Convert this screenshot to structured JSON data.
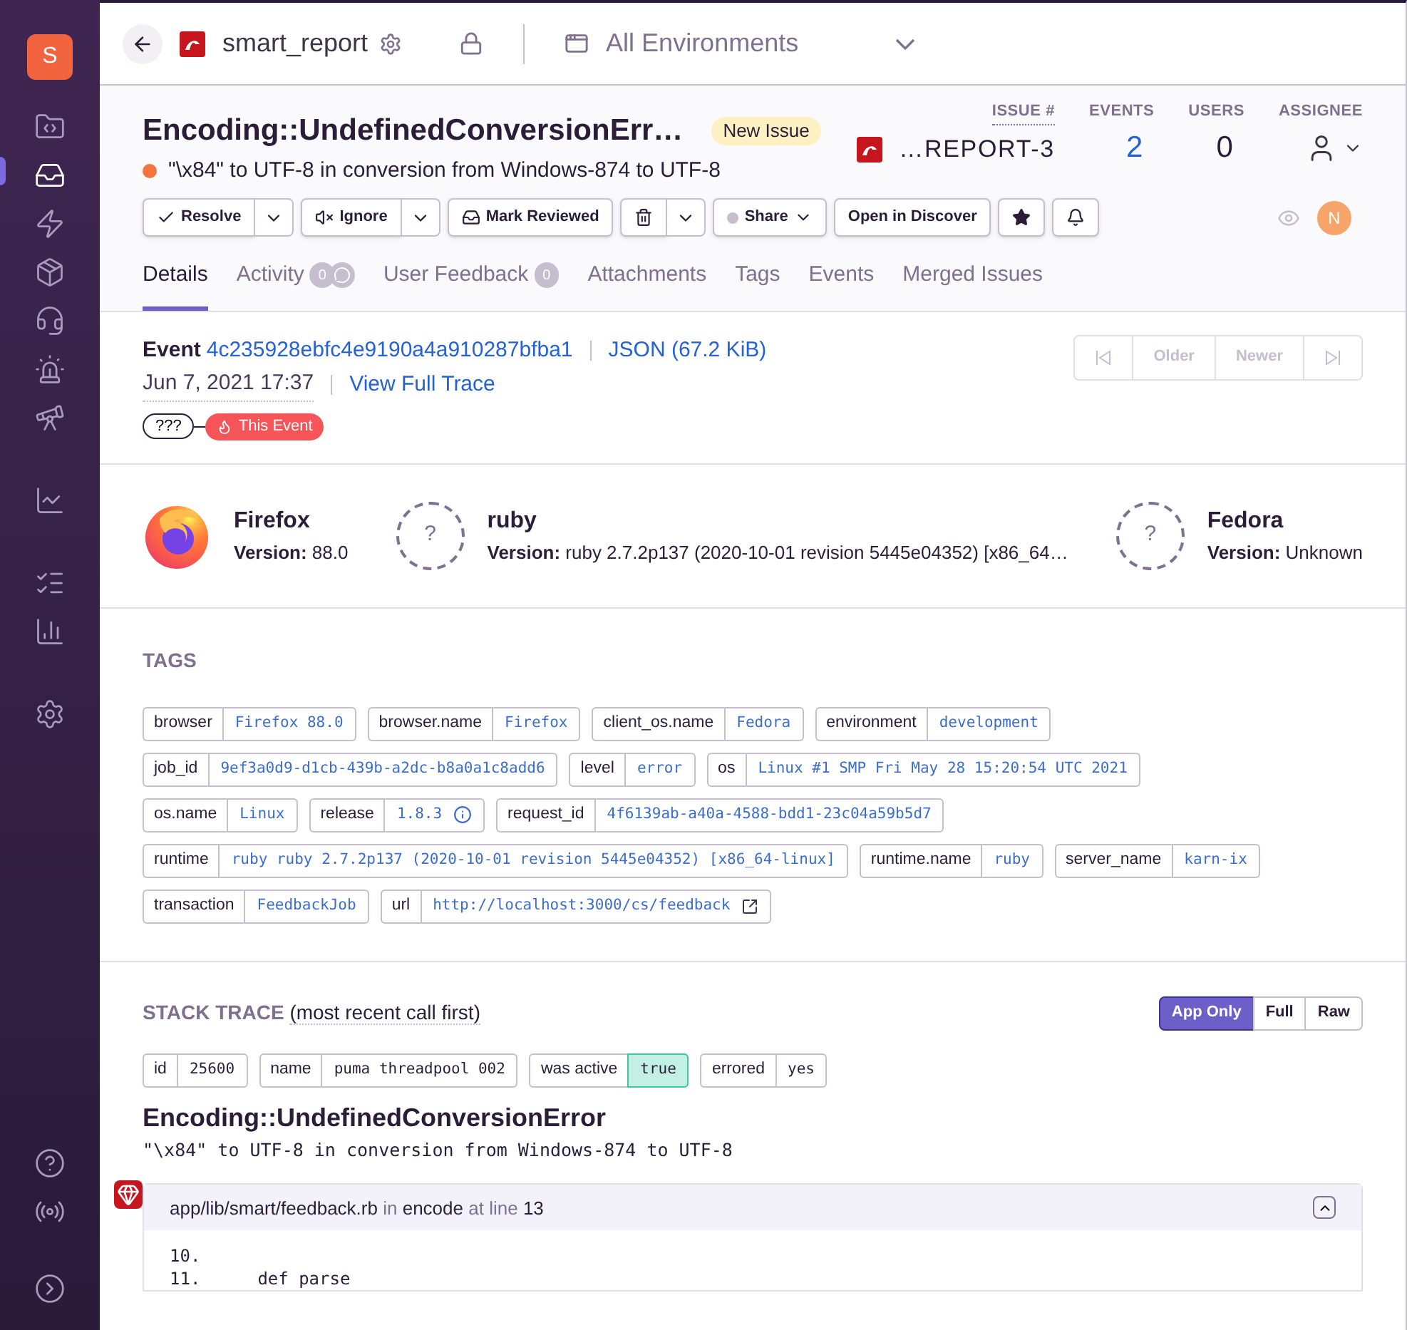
{
  "sidebar": {
    "org_initial": "S",
    "items": [
      {
        "selected": false
      },
      {
        "selected": true
      },
      {
        "selected": false
      },
      {
        "selected": false
      },
      {
        "selected": false
      },
      {
        "selected": false
      },
      {
        "selected": false
      },
      {
        "selected": false
      },
      {
        "selected": false
      },
      {
        "selected": false
      },
      {
        "selected": false
      }
    ]
  },
  "top_bar": {
    "project": "smart_report",
    "environment": "All Environments"
  },
  "issue": {
    "title": "Encoding::UndefinedConversionErr…",
    "badge": "New Issue",
    "message": "\"\\x84\" to UTF-8 in conversion from Windows-874 to UTF-8",
    "stats": [
      {
        "label": "ISSUE #",
        "value": "…REPORT-3",
        "kind": "id"
      },
      {
        "label": "EVENTS",
        "value": "2",
        "kind": "link"
      },
      {
        "label": "USERS",
        "value": "0",
        "kind": "plain"
      },
      {
        "label": "ASSIGNEE",
        "kind": "assignee"
      }
    ],
    "actions": [
      {
        "label": "Resolve",
        "kind": "split"
      },
      {
        "label": "Ignore",
        "kind": "split"
      },
      {
        "label": "Mark Reviewed",
        "kind": "plain"
      },
      {
        "kind": "split"
      },
      {
        "label": "Share",
        "kind": "menu"
      },
      {
        "label": "Open in Discover",
        "kind": "plain"
      },
      {
        "kind": "plain"
      },
      {
        "kind": "plain"
      }
    ],
    "viewer_initial": "N",
    "tabs": [
      {
        "label": "Details",
        "selected": true
      },
      {
        "label": "Activity",
        "count": "0",
        "selected": false
      },
      {
        "label": "User Feedback",
        "count": "0",
        "selected": false
      },
      {
        "label": "Attachments",
        "selected": false
      },
      {
        "label": "Tags",
        "selected": false
      },
      {
        "label": "Events",
        "selected": false
      },
      {
        "label": "Merged Issues",
        "selected": false
      }
    ]
  },
  "event": {
    "label": "Event",
    "id": "4c235928ebfc4e9190a4a910287bfba1",
    "json": "JSON (67.2 KiB)",
    "date": "Jun 7, 2021 17:37",
    "trace": "View Full Trace",
    "nav": [
      {
        "disabled": true
      },
      {
        "label": "Older",
        "disabled": true
      },
      {
        "label": "Newer",
        "disabled": true
      },
      {
        "disabled": true
      }
    ],
    "trace_node": "???",
    "this_event": "This Event"
  },
  "contexts": [
    {
      "name": "Firefox",
      "version_label": "Version:",
      "version": "88.0",
      "kind": "firefox"
    },
    {
      "name": "ruby",
      "version_label": "Version:",
      "version": "ruby 2.7.2p137 (2020-10-01 revision 5445e04352) [x86_64…",
      "kind": "unknown",
      "glyph": "?"
    },
    {
      "name": "Fedora",
      "version_label": "Version:",
      "version": "Unknown",
      "kind": "unknown",
      "glyph": "?"
    }
  ],
  "tags": {
    "title": "TAGS",
    "items": [
      {
        "key": "browser",
        "value": "Firefox 88.0",
        "kind": "plain"
      },
      {
        "key": "browser.name",
        "value": "Firefox",
        "kind": "plain"
      },
      {
        "key": "client_os.name",
        "value": "Fedora",
        "kind": "plain"
      },
      {
        "key": "environment",
        "value": "development",
        "kind": "plain"
      },
      {
        "key": "job_id",
        "value": "9ef3a0d9-d1cb-439b-a2dc-b8a0a1c8add6",
        "kind": "plain"
      },
      {
        "key": "level",
        "value": "error",
        "kind": "plain"
      },
      {
        "key": "os",
        "value": "Linux #1 SMP Fri May 28 15:20:54 UTC 2021",
        "kind": "plain"
      },
      {
        "key": "os.name",
        "value": "Linux",
        "kind": "plain"
      },
      {
        "key": "release",
        "value": "1.8.3",
        "kind": "info"
      },
      {
        "key": "request_id",
        "value": "4f6139ab-a40a-4588-bdd1-23c04a59b5d7",
        "kind": "plain"
      },
      {
        "key": "runtime",
        "value": "ruby ruby 2.7.2p137 (2020-10-01 revision 5445e04352) [x86_64-linux]",
        "kind": "plain"
      },
      {
        "key": "runtime.name",
        "value": "ruby",
        "kind": "plain"
      },
      {
        "key": "server_name",
        "value": "karn-ix",
        "kind": "plain"
      },
      {
        "key": "transaction",
        "value": "FeedbackJob",
        "kind": "plain"
      },
      {
        "key": "url",
        "value": "http://localhost:3000/cs/feedback",
        "kind": "link"
      }
    ]
  },
  "stack_trace": {
    "title": "STACK TRACE",
    "subtitle": "(most recent call first)",
    "views": [
      {
        "label": "App Only",
        "selected": true
      },
      {
        "label": "Full",
        "selected": false
      },
      {
        "label": "Raw",
        "selected": false
      }
    ],
    "thread": [
      {
        "key": "id",
        "value": "25600",
        "highlighted": false
      },
      {
        "key": "name",
        "value": "puma threadpool 002",
        "highlighted": false
      },
      {
        "key": "was active",
        "value": "true",
        "highlighted": true
      },
      {
        "key": "errored",
        "value": "yes",
        "highlighted": false
      }
    ],
    "exception": "Encoding::UndefinedConversionError",
    "exception_message": "\"\\x84\" to UTF-8 in conversion from Windows-874 to UTF-8",
    "frame": {
      "file": "app/lib/smart/feedback.rb",
      "in": "in",
      "function": "encode",
      "at": "at line",
      "line": "13",
      "expanded": true,
      "lines": [
        {
          "number": "10."
        },
        {
          "number": "11.",
          "code": "def parse"
        }
      ]
    }
  }
}
